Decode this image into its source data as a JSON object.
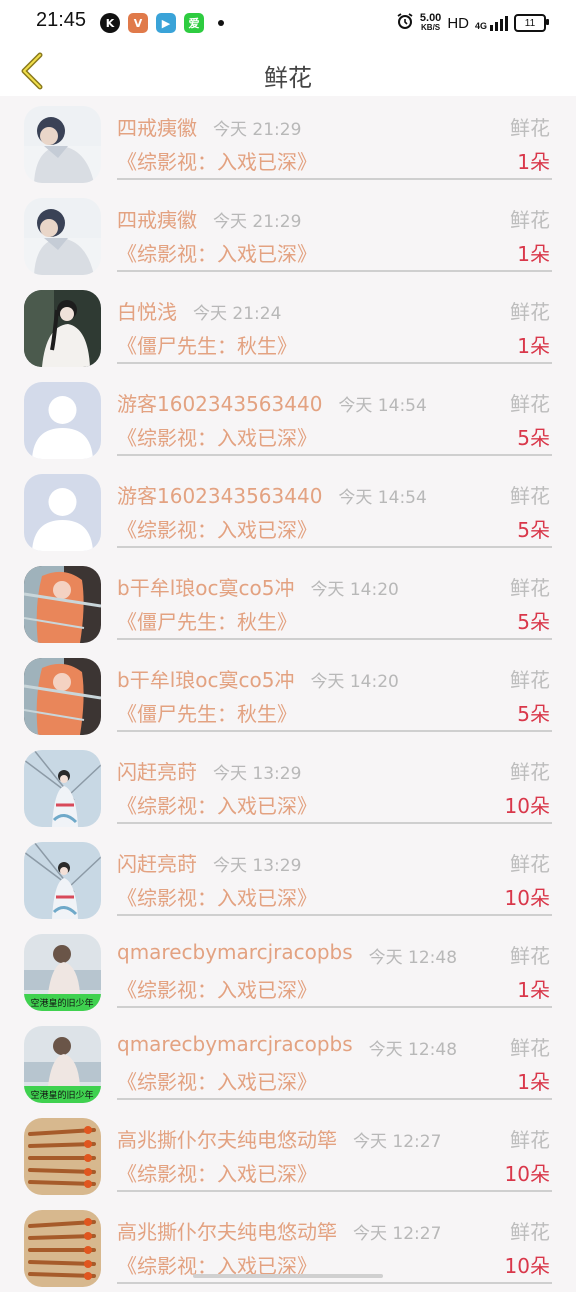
{
  "status_bar": {
    "time": "21:45",
    "speed_value": "5.00",
    "speed_unit": "KB/S",
    "hd": "HD",
    "network": "4G",
    "battery": "11"
  },
  "header": {
    "title": "鲜花"
  },
  "rows": [
    {
      "name": "四戒痍徽",
      "time": "今天 21:29",
      "gift": "鲜花",
      "book": "《综影视：入戏已深》",
      "count": "1朵",
      "avatar": "person-dark"
    },
    {
      "name": "四戒痍徽",
      "time": "今天 21:29",
      "gift": "鲜花",
      "book": "《综影视：入戏已深》",
      "count": "1朵",
      "avatar": "person-dark"
    },
    {
      "name": "白悦浅",
      "time": "今天 21:24",
      "gift": "鲜花",
      "book": "《僵尸先生：秋生》",
      "count": "1朵",
      "avatar": "girl-white"
    },
    {
      "name": "游客1602343563440",
      "time": "今天 14:54",
      "gift": "鲜花",
      "book": "《综影视：入戏已深》",
      "count": "5朵",
      "avatar": "default"
    },
    {
      "name": "游客1602343563440",
      "time": "今天 14:54",
      "gift": "鲜花",
      "book": "《综影视：入戏已深》",
      "count": "5朵",
      "avatar": "default"
    },
    {
      "name": "b干牟l琅oc寞co5冲",
      "time": "今天 14:20",
      "gift": "鲜花",
      "book": "《僵尸先生：秋生》",
      "count": "5朵",
      "avatar": "orange-hair"
    },
    {
      "name": "b干牟l琅oc寞co5冲",
      "time": "今天 14:20",
      "gift": "鲜花",
      "book": "《僵尸先生：秋生》",
      "count": "5朵",
      "avatar": "orange-hair"
    },
    {
      "name": "闪赶亮莳",
      "time": "今天 13:29",
      "gift": "鲜花",
      "book": "《综影视：入戏已深》",
      "count": "10朵",
      "avatar": "hanfu-girl"
    },
    {
      "name": "闪赶亮莳",
      "time": "今天 13:29",
      "gift": "鲜花",
      "book": "《综影视：入戏已深》",
      "count": "10朵",
      "avatar": "hanfu-girl"
    },
    {
      "name": "qmarecbymarcjracopbs",
      "time": "今天 12:48",
      "gift": "鲜花",
      "book": "《综影视：入戏已深》",
      "count": "1朵",
      "avatar": "beach-girl"
    },
    {
      "name": "qmarecbymarcjracopbs",
      "time": "今天 12:48",
      "gift": "鲜花",
      "book": "《综影视：入戏已深》",
      "count": "1朵",
      "avatar": "beach-girl"
    },
    {
      "name": "高兆撕仆尔夫纯电悠动筚",
      "time": "今天 12:27",
      "gift": "鲜花",
      "book": "《综影视：入戏已深》",
      "count": "10朵",
      "avatar": "tools"
    },
    {
      "name": "高兆撕仆尔夫纯电悠动筚",
      "time": "今天 12:27",
      "gift": "鲜花",
      "book": "《综影视：入戏已深》",
      "count": "10朵",
      "avatar": "tools"
    }
  ],
  "colors": {
    "accent_text": "#e3a281",
    "count_red": "#d9374a",
    "back_arrow": "#8a7a1e"
  }
}
